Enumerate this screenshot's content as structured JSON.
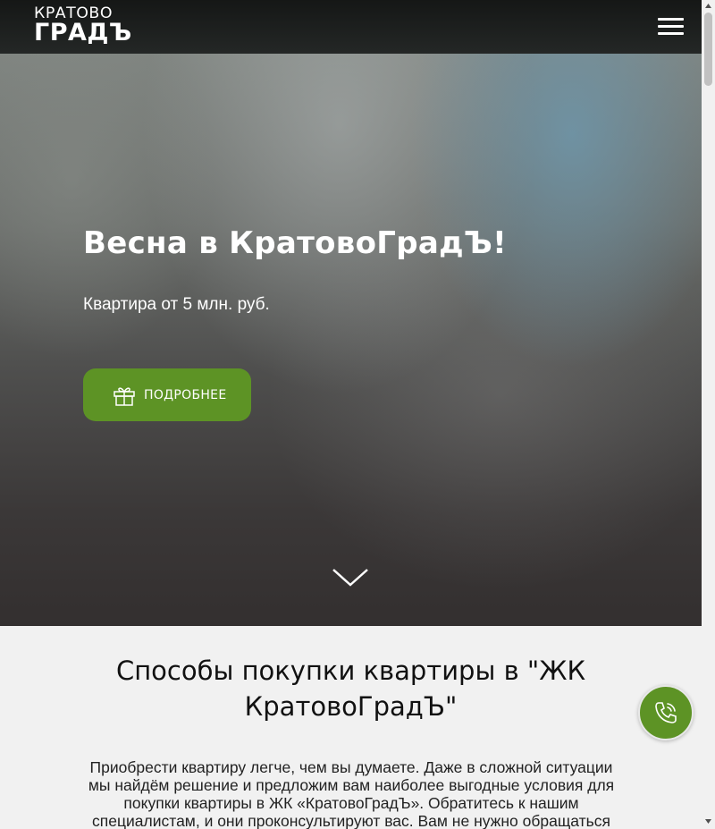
{
  "header": {
    "logo_line1": "КРАТОВО",
    "logo_line2": "ГРАДЪ",
    "menu_icon": "hamburger-menu-icon"
  },
  "hero": {
    "title": "Весна в КратовоГрадЪ!",
    "subtitle": "Квартира от 5 млн. руб.",
    "button_label": "ПОДРОБНЕЕ",
    "button_icon": "gift-icon",
    "scroll_icon": "chevron-down-icon"
  },
  "section": {
    "title_line1": "Способы покупки квартиры в \"ЖК",
    "title_line2": "КратовоГрадЪ\"",
    "text": "Приобрести квартиру легче, чем вы думаете. Даже в сложной ситуации мы найдём решение и предложим вам наиболее выгодные условия для покупки квартиры в ЖК «КратовоГрадЪ». Обратитесь к нашим специалистам, и они проконсультируют вас. Вам не нужно обращаться"
  },
  "call_button": {
    "icon": "phone-icon"
  },
  "colors": {
    "accent_green": "#5d9325",
    "header_bg": "#1b1d1c",
    "section_bg": "#f1f1f1"
  }
}
